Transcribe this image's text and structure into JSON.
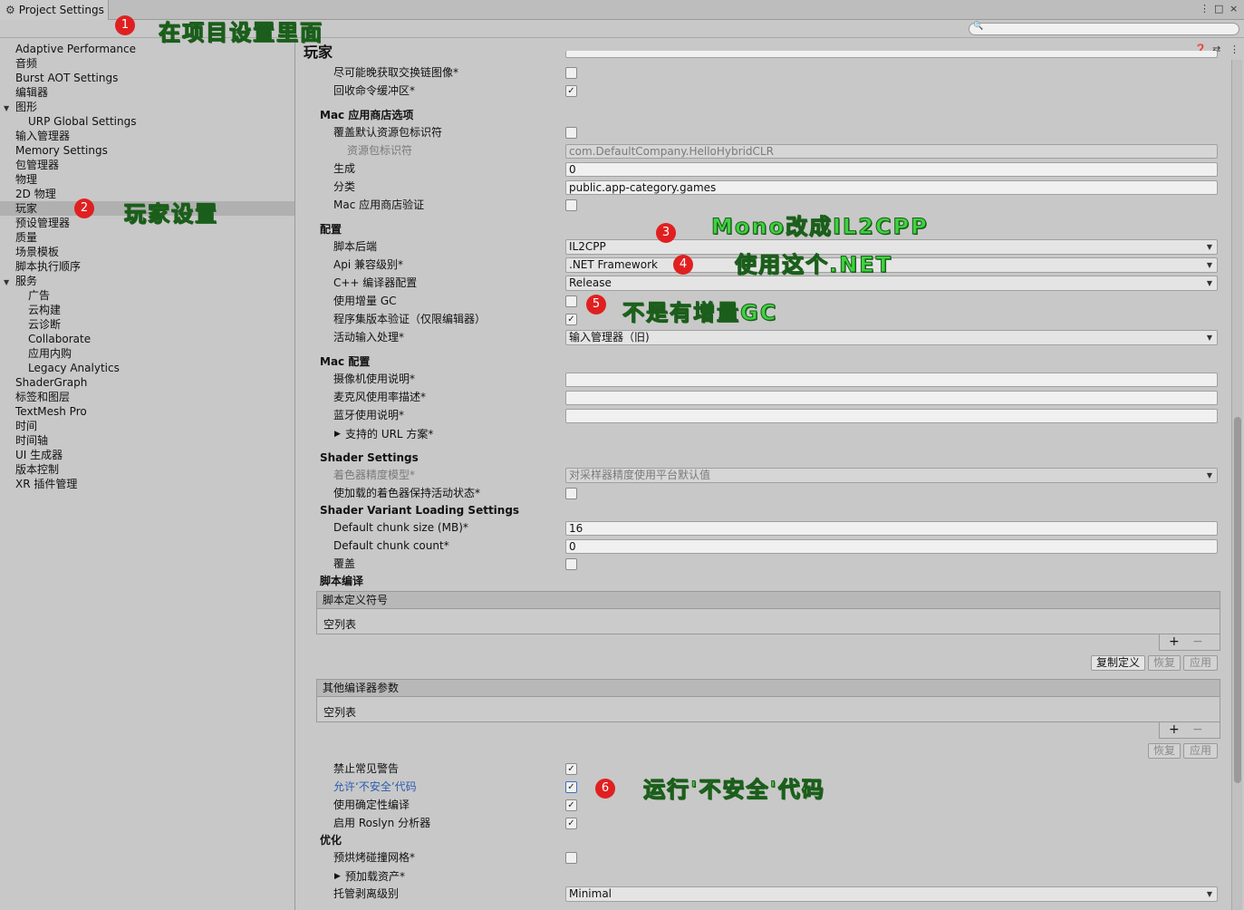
{
  "window": {
    "tab_title": "Project Settings",
    "controls": [
      "⋮",
      "□",
      "×"
    ]
  },
  "search": {
    "placeholder": ""
  },
  "sidebar": {
    "items": [
      "Adaptive Performance",
      "音频",
      "Burst AOT Settings",
      "编辑器",
      "图形",
      "URP Global Settings",
      "输入管理器",
      "Memory Settings",
      "包管理器",
      "物理",
      "2D 物理",
      "玩家",
      "预设管理器",
      "质量",
      "场景模板",
      "脚本执行顺序",
      "服务",
      "广告",
      "云构建",
      "云诊断",
      "Collaborate",
      "应用内购",
      "Legacy Analytics",
      "ShaderGraph",
      "标签和图层",
      "TextMesh Pro",
      "时间",
      "时间轴",
      "UI 生成器",
      "版本控制",
      "XR 插件管理"
    ],
    "selected": "玩家"
  },
  "main": {
    "title": "玩家",
    "rows": {
      "lazy_swapchain": "尽可能晚获取交换链图像*",
      "recycle_cmd": "回收命令缓冲区*",
      "mac_store_section": "Mac 应用商店选项",
      "override_bundle": "覆盖默认资源包标识符",
      "bundle_id_label": "资源包标识符",
      "bundle_id_value": "com.DefaultCompany.HelloHybridCLR",
      "build_label": "生成",
      "build_value": "0",
      "category_label": "分类",
      "category_value": "public.app-category.games",
      "mac_store_validation": "Mac 应用商店验证",
      "config_section": "配置",
      "scripting_backend_label": "脚本后端",
      "scripting_backend_value": "IL2CPP",
      "api_level_label": "Api 兼容级别*",
      "api_level_value": ".NET Framework",
      "cpp_config_label": "C++ 编译器配置",
      "cpp_config_value": "Release",
      "incremental_gc": "使用增量 GC",
      "assembly_validation": "程序集版本验证（仅限编辑器）",
      "input_handling_label": "活动输入处理*",
      "input_handling_value": "输入管理器（旧)",
      "mac_config_section": "Mac 配置",
      "camera_usage": "摄像机使用说明*",
      "mic_usage": "麦克风使用率描述*",
      "bluetooth_usage": "蓝牙使用说明*",
      "url_schemes": "支持的 URL 方案*",
      "shader_settings_section": "Shader Settings",
      "shader_precision_label": "着色器精度模型*",
      "shader_precision_value": "对采样器精度使用平台默认值",
      "keep_shaders_alive": "使加载的着色器保持活动状态*",
      "svl_section": "Shader Variant Loading Settings",
      "chunk_size_label": "Default chunk size (MB)*",
      "chunk_size_value": "16",
      "chunk_count_label": "Default chunk count*",
      "chunk_count_value": "0",
      "override": "覆盖",
      "script_compile_section": "脚本编译",
      "define_symbols_header": "脚本定义符号",
      "empty_list_1": "空列表",
      "copy_defines": "复制定义",
      "revert_1": "恢复",
      "apply_1": "应用",
      "extra_args_header": "其他编译器参数",
      "empty_list_2": "空列表",
      "revert_2": "恢复",
      "apply_2": "应用",
      "suppress_warnings": "禁止常见警告",
      "allow_unsafe": "允许‘不安全’代码",
      "deterministic": "使用确定性编译",
      "roslyn": "启用 Roslyn 分析器",
      "optimization_section": "优化",
      "prebake_collision": "预烘烤碰撞网格*",
      "preload_assets": "预加载资产*",
      "stripping_label": "托管剥离级别",
      "stripping_value": "Minimal",
      "plus": "+",
      "minus": "−"
    }
  },
  "annotations": {
    "b1": "1",
    "t1": "在项目设置里面",
    "b2": "2",
    "t2": "玩家设置",
    "b3": "3",
    "t3": "Mono改成IL2CPP",
    "b4": "4",
    "t4": "使用这个.NET",
    "b5": "5",
    "t5": "不是有增量GC",
    "b6": "6",
    "t6": "运行'不安全'代码"
  },
  "colors": {
    "annotation_text": "#3fd23f",
    "badge": "#e02020",
    "link": "#2a5db0"
  }
}
